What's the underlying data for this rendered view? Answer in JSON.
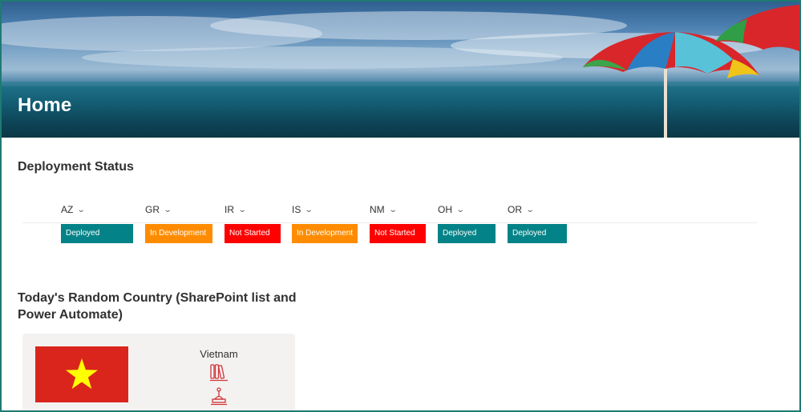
{
  "hero": {
    "title": "Home"
  },
  "deployment": {
    "title": "Deployment Status",
    "columns": [
      {
        "code": "AZ",
        "status": "Deployed",
        "color": "#038387"
      },
      {
        "code": "GR",
        "status": "In Development",
        "color": "#ff8c00"
      },
      {
        "code": "IR",
        "status": "Not Started",
        "color": "#ff0000"
      },
      {
        "code": "IS",
        "status": "In Development",
        "color": "#ff8c00"
      },
      {
        "code": "NM",
        "status": "Not Started",
        "color": "#ff0000"
      },
      {
        "code": "OH",
        "status": "Deployed",
        "color": "#038387"
      },
      {
        "code": "OR",
        "status": "Deployed",
        "color": "#038387"
      }
    ]
  },
  "random_country": {
    "title": "Today's Random Country (SharePoint list and Power Automate)",
    "country": "Vietnam",
    "flag_colors": {
      "field": "#da251d",
      "star": "#ffff00"
    },
    "icons": [
      "library-icon",
      "monument-icon"
    ]
  },
  "colors": {
    "frame_border": "#1f7a72",
    "icon_red": "#d13438"
  }
}
